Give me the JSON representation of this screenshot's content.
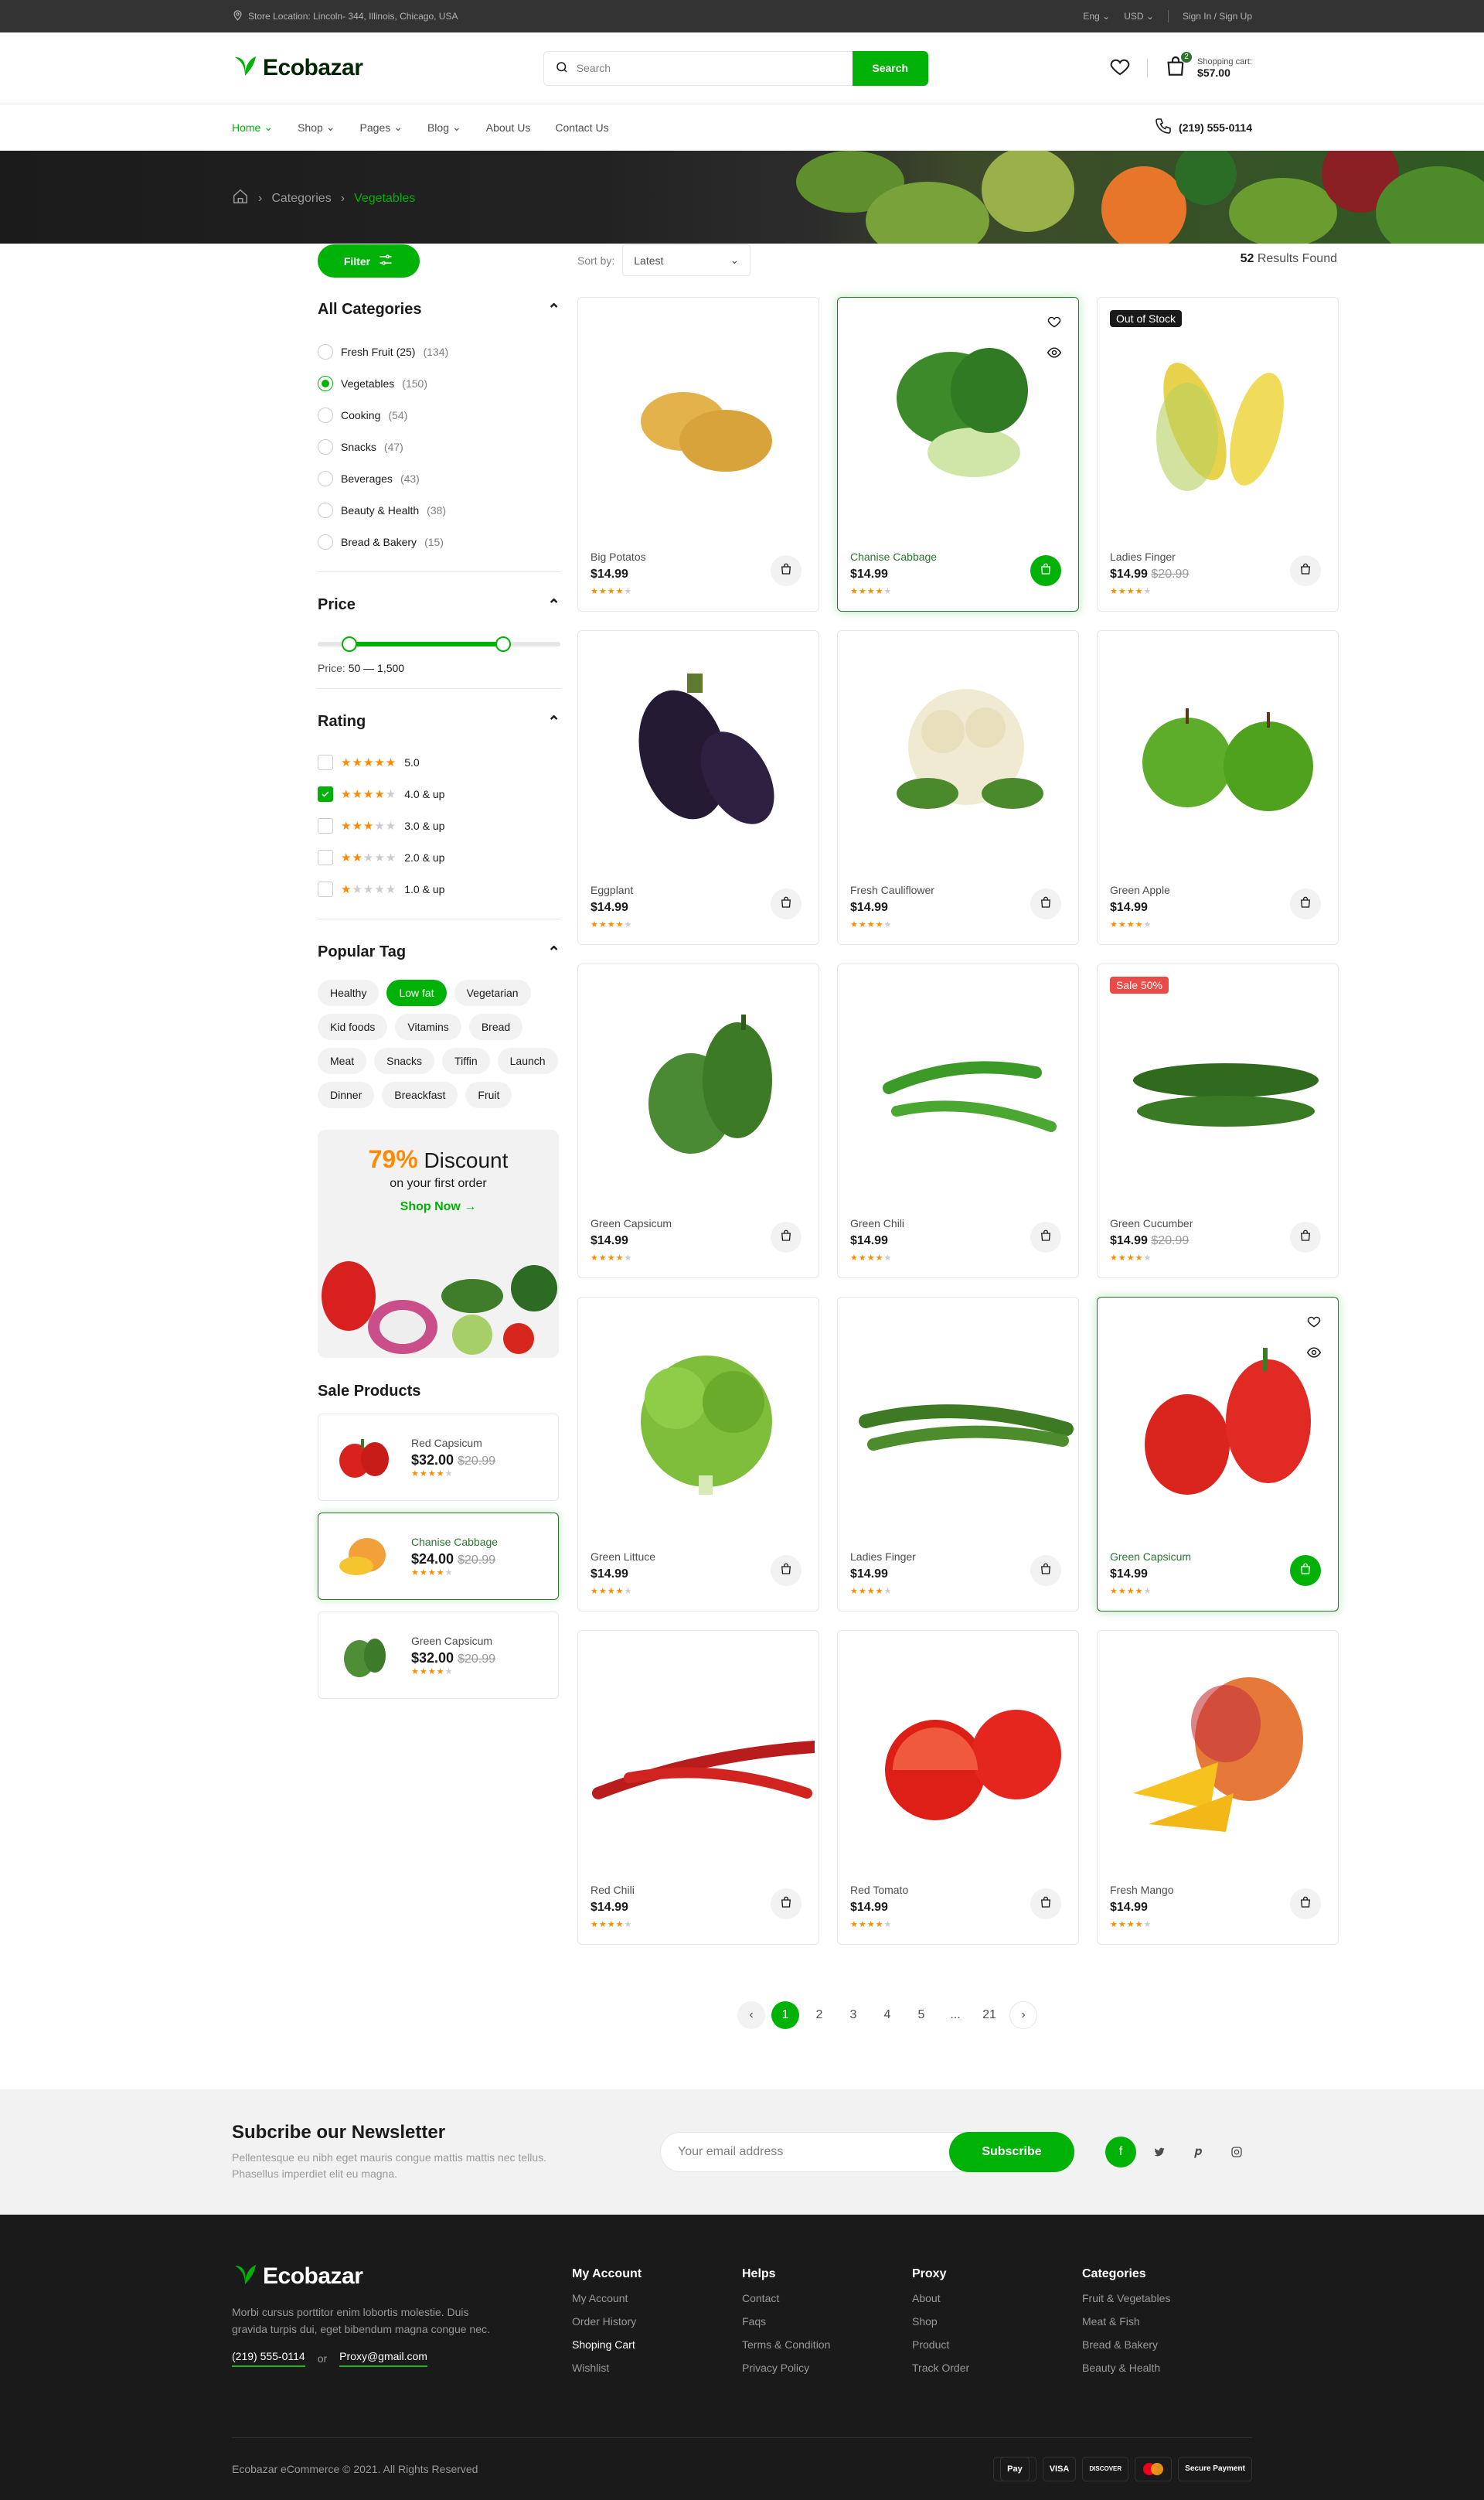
{
  "topbar": {
    "location": "Store Location: Lincoln- 344, Illinois, Chicago, USA",
    "lang": "Eng",
    "currency": "USD",
    "auth": "Sign In / Sign Up"
  },
  "header": {
    "brand": "Ecobazar",
    "search_placeholder": "Search",
    "search_button": "Search",
    "cart_label": "Shopping cart:",
    "cart_total": "$57.00",
    "cart_count": "2"
  },
  "nav": {
    "items": [
      "Home",
      "Shop",
      "Pages",
      "Blog",
      "About Us",
      "Contact Us"
    ],
    "phone": "(219) 555-0114"
  },
  "breadcrumb": {
    "items": [
      "Categories",
      "Vegetables"
    ]
  },
  "toolbar": {
    "filter": "Filter",
    "sort_label": "Sort by:",
    "sort_value": "Latest",
    "results_count": "52",
    "results_label": "Results Found"
  },
  "sidebar": {
    "categories_title": "All Categories",
    "categories": [
      {
        "name": "Fresh Fruit (25)",
        "count": "(134)"
      },
      {
        "name": "Vegetables",
        "count": "(150)"
      },
      {
        "name": "Cooking",
        "count": "(54)"
      },
      {
        "name": "Snacks",
        "count": "(47)"
      },
      {
        "name": "Beverages",
        "count": "(43)"
      },
      {
        "name": "Beauty & Health",
        "count": "(38)"
      },
      {
        "name": "Bread & Bakery",
        "count": "(15)"
      }
    ],
    "price_title": "Price",
    "price_label": "Price:",
    "price_range": "50 — 1,500",
    "price_min_fraction": 0.13,
    "price_max_fraction": 0.77,
    "rating_title": "Rating",
    "ratings": [
      {
        "label": "5.0",
        "stars": 5
      },
      {
        "label": "4.0 & up",
        "stars": 4
      },
      {
        "label": "3.0 & up",
        "stars": 3
      },
      {
        "label": "2.0 & up",
        "stars": 2
      },
      {
        "label": "1.0 & up",
        "stars": 1
      }
    ],
    "tags_title": "Popular Tag",
    "tags": [
      "Healthy",
      "Low fat",
      "Vegetarian",
      "Kid foods",
      "Vitamins",
      "Bread",
      "Meat",
      "Snacks",
      "Tiffin",
      "Launch",
      "Dinner",
      "Breackfast",
      "Fruit"
    ],
    "promo": {
      "percent": "79%",
      "word": "Discount",
      "sub": "on your first order",
      "cta": "Shop Now"
    },
    "sale_title": "Sale Products",
    "sale_items": [
      {
        "name": "Red Capsicum",
        "price": "$32.00",
        "old": "$20.99"
      },
      {
        "name": "Chanise Cabbage",
        "price": "$24.00",
        "old": "$20.99"
      },
      {
        "name": "Green Capsicum",
        "price": "$32.00",
        "old": "$20.99"
      }
    ]
  },
  "products": [
    {
      "name": "Big Potatos",
      "price": "$14.99",
      "old": "",
      "badge": ""
    },
    {
      "name": "Chanise Cabbage",
      "price": "$14.99",
      "old": "",
      "badge": ""
    },
    {
      "name": "Ladies Finger",
      "price": "$14.99",
      "old": "$20.99",
      "badge": "Out of Stock"
    },
    {
      "name": "Eggplant",
      "price": "$14.99",
      "old": "",
      "badge": ""
    },
    {
      "name": "Fresh Cauliflower",
      "price": "$14.99",
      "old": "",
      "badge": ""
    },
    {
      "name": "Green Apple",
      "price": "$14.99",
      "old": "",
      "badge": ""
    },
    {
      "name": "Green Capsicum",
      "price": "$14.99",
      "old": "",
      "badge": ""
    },
    {
      "name": "Green Chili",
      "price": "$14.99",
      "old": "",
      "badge": ""
    },
    {
      "name": "Green Cucumber",
      "price": "$14.99",
      "old": "$20.99",
      "badge": "Sale 50%"
    },
    {
      "name": "Green Littuce",
      "price": "$14.99",
      "old": "",
      "badge": ""
    },
    {
      "name": "Ladies Finger",
      "price": "$14.99",
      "old": "",
      "badge": ""
    },
    {
      "name": "Green Capsicum",
      "price": "$14.99",
      "old": "",
      "badge": ""
    },
    {
      "name": "Red Chili",
      "price": "$14.99",
      "old": "",
      "badge": ""
    },
    {
      "name": "Red Tomato",
      "price": "$14.99",
      "old": "",
      "badge": ""
    },
    {
      "name": "Fresh Mango",
      "price": "$14.99",
      "old": "",
      "badge": ""
    }
  ],
  "pagination": [
    "1",
    "2",
    "3",
    "4",
    "5",
    "...",
    "21"
  ],
  "newsletter": {
    "title": "Subcribe our Newsletter",
    "text": "Pellentesque eu nibh eget mauris congue mattis mattis nec tellus. Phasellus imperdiet elit eu magna.",
    "placeholder": "Your email address",
    "button": "Subscribe"
  },
  "footer": {
    "brand": "Ecobazar",
    "about": "Morbi cursus porttitor enim lobortis molestie. Duis gravida turpis dui, eget bibendum magna congue nec.",
    "phone": "(219) 555-0114",
    "or": "or",
    "email": "Proxy@gmail.com",
    "cols": [
      {
        "title": "My Account",
        "links": [
          "My Account",
          "Order History",
          "Shoping Cart",
          "Wishlist"
        ]
      },
      {
        "title": "Helps",
        "links": [
          "Contact",
          "Faqs",
          "Terms & Condition",
          "Privacy Policy"
        ]
      },
      {
        "title": "Proxy",
        "links": [
          "About",
          "Shop",
          "Product",
          "Track Order"
        ]
      },
      {
        "title": "Categories",
        "links": [
          "Fruit & Vegetables",
          "Meat & Fish",
          "Bread & Bakery",
          "Beauty & Health"
        ]
      }
    ],
    "copyright": "Ecobazar eCommerce © 2021. All Rights Reserved",
    "payments": [
      "Pay",
      "VISA",
      "DISCOVER",
      "Secure Payment"
    ]
  },
  "colors": {
    "brand_green": "#00b207",
    "dark_green": "#2c742f",
    "orange": "#ff8a00",
    "sale_red": "#ea4b48"
  }
}
